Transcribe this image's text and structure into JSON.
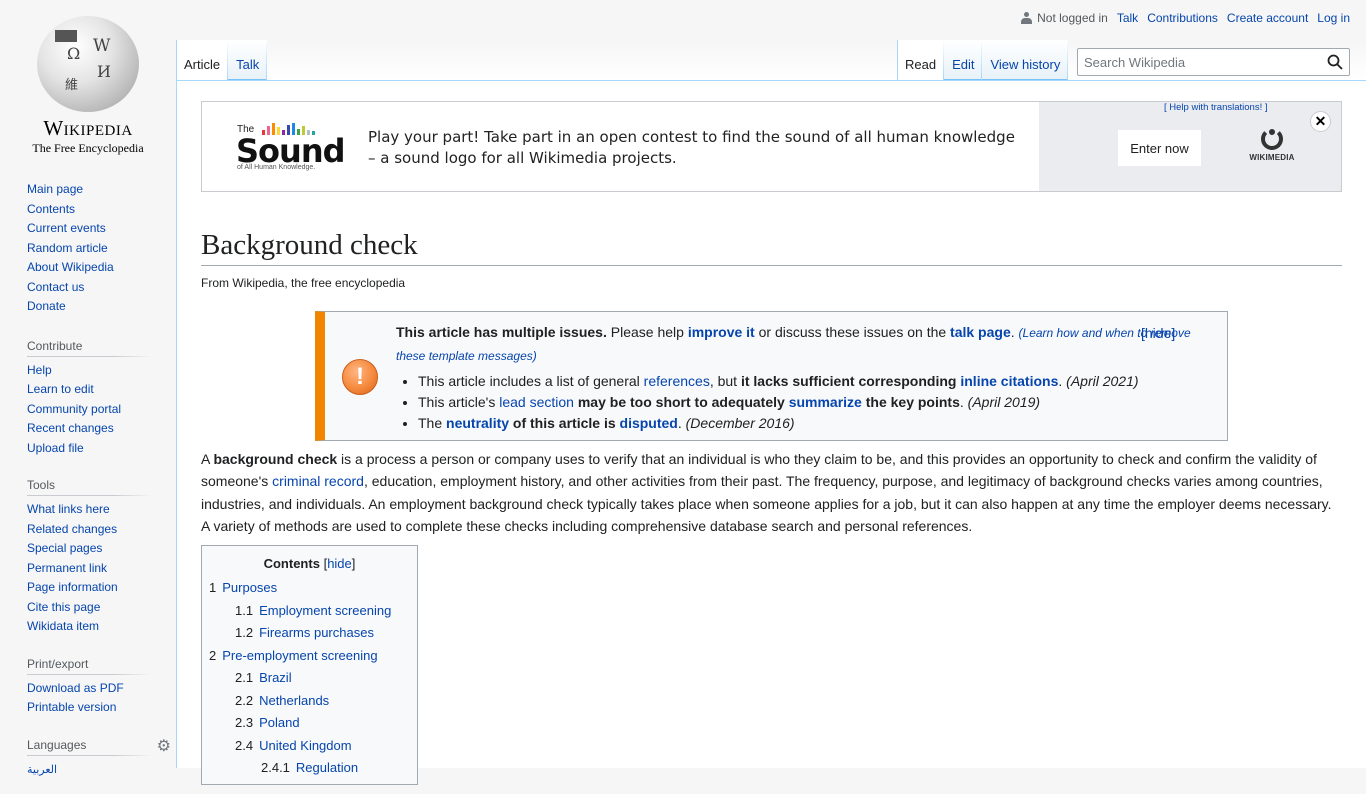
{
  "logo": {
    "wordmark": "Wikipedia",
    "tagline": "The Free Encyclopedia",
    "icon": "puzzle-globe-icon"
  },
  "personal": {
    "status": "Not logged in",
    "links": [
      "Talk",
      "Contributions",
      "Create account",
      "Log in"
    ]
  },
  "tabs": {
    "left": [
      {
        "label": "Article",
        "selected": true
      },
      {
        "label": "Talk",
        "selected": false
      }
    ],
    "right": [
      {
        "label": "Read",
        "selected": true
      },
      {
        "label": "Edit",
        "selected": false
      },
      {
        "label": "View history",
        "selected": false
      }
    ]
  },
  "search": {
    "placeholder": "Search Wikipedia",
    "value": "",
    "icon": "search-icon"
  },
  "sidebar": {
    "navigation": [
      "Main page",
      "Contents",
      "Current events",
      "Random article",
      "About Wikipedia",
      "Contact us",
      "Donate"
    ],
    "contribute": {
      "heading": "Contribute",
      "items": [
        "Help",
        "Learn to edit",
        "Community portal",
        "Recent changes",
        "Upload file"
      ]
    },
    "tools": {
      "heading": "Tools",
      "items": [
        "What links here",
        "Related changes",
        "Special pages",
        "Permanent link",
        "Page information",
        "Cite this page",
        "Wikidata item"
      ]
    },
    "print": {
      "heading": "Print/export",
      "items": [
        "Download as PDF",
        "Printable version"
      ]
    },
    "languages": {
      "heading": "Languages",
      "items": [
        "العربية"
      ]
    }
  },
  "banner": {
    "logo_the": "The",
    "logo_word": "Sound",
    "logo_sub": "of All Human Knowledge.",
    "text": "Play your part! Take part in an open contest to find the sound of all human knowledge – a sound logo for all Wikimedia projects.",
    "help_link": "[ Help with translations! ]",
    "button": "Enter now",
    "wm_text": "WIKIMEDIA",
    "bar_colors": [
      "#e53935",
      "#f06292",
      "#fb8c00",
      "#fdd835",
      "#8e24aa",
      "#3949ab",
      "#1e88e5",
      "#43a047",
      "#c0ca33",
      "#b0bec5",
      "#26a69a"
    ]
  },
  "article": {
    "title": "Background check",
    "tagline": "From Wikipedia, the free encyclopedia",
    "ambox": {
      "heading": "This article has multiple issues.",
      "text1": " Please help ",
      "improve": "improve it",
      "text2": " or discuss these issues on the ",
      "talk": "talk page",
      "text3": ". ",
      "learn": "(Learn how and when to remove these template messages)",
      "hide": "[hide]",
      "issues": [
        {
          "a": "This article includes a list of general ",
          "link1": "references",
          "b": ", but ",
          "bold": "it lacks sufficient corresponding ",
          "link2": "inline citations",
          "c": ".",
          "date": "(April 2021)"
        },
        {
          "a": "This article's ",
          "link1": "lead section",
          "b": " ",
          "bold": "may be too short to adequately ",
          "link2": "summarize",
          "bold2": " the key points",
          "c": ".",
          "date": "(April 2019)"
        },
        {
          "a": "The ",
          "link1": "neutrality",
          "bold": " of this article is ",
          "link2": "disputed",
          "c": ".",
          "date": "(December 2016)"
        }
      ]
    },
    "lead": {
      "p1": "A ",
      "bold": "background check",
      "p2": " is a process a person or company uses to verify that an individual is who they claim to be, and this provides an opportunity to check and confirm the validity of someone's ",
      "link": "criminal record",
      "p3": ", education, employment history, and other activities from their past. The frequency, purpose, and legitimacy of background checks varies among countries, industries, and individuals. An employment background check typically takes place when someone applies for a job, but it can also happen at any time the employer deems necessary. A variety of methods are used to complete these checks including comprehensive database search and personal references."
    },
    "toc": {
      "title": "Contents",
      "hide": "hide",
      "items": [
        {
          "num": "1",
          "label": "Purposes",
          "level": 1
        },
        {
          "num": "1.1",
          "label": "Employment screening",
          "level": 2
        },
        {
          "num": "1.2",
          "label": "Firearms purchases",
          "level": 2
        },
        {
          "num": "2",
          "label": "Pre-employment screening",
          "level": 1
        },
        {
          "num": "2.1",
          "label": "Brazil",
          "level": 2
        },
        {
          "num": "2.2",
          "label": "Netherlands",
          "level": 2
        },
        {
          "num": "2.3",
          "label": "Poland",
          "level": 2
        },
        {
          "num": "2.4",
          "label": "United Kingdom",
          "level": 2
        },
        {
          "num": "2.4.1",
          "label": "Regulation",
          "level": 3
        }
      ]
    }
  }
}
